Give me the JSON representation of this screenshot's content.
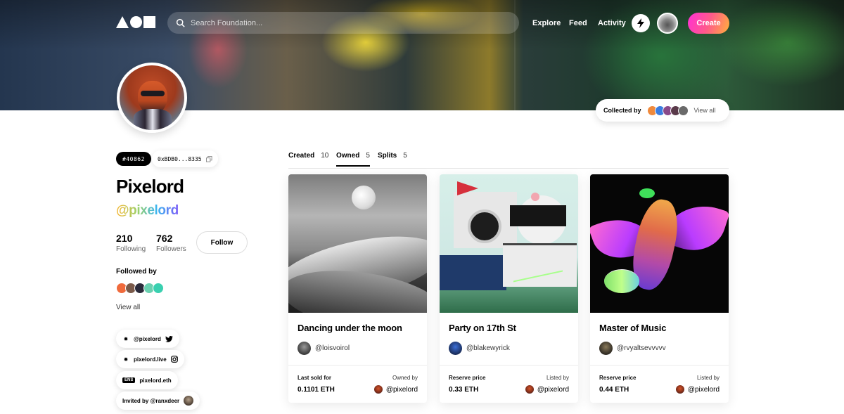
{
  "nav": {
    "search_placeholder": "Search Foundation...",
    "links": [
      "Explore",
      "Feed",
      "Activity"
    ],
    "create_label": "Create"
  },
  "collected": {
    "label": "Collected by",
    "view_all": "View all",
    "avatar_colors": [
      "#f08a3c",
      "#3b7de0",
      "#8a4a8a",
      "#5a3a4a",
      "#6a6a6a"
    ]
  },
  "profile": {
    "token_id": "#40862",
    "address": "0xBDB0...8335",
    "name": "Pixelord",
    "handle": "@pixelord",
    "following_count": "210",
    "following_label": "Following",
    "followers_count": "762",
    "followers_label": "Followers",
    "follow_label": "Follow",
    "followed_by_label": "Followed by",
    "followed_by_colors": [
      "#f06a3c",
      "#7a5a4a",
      "#2a2a3a",
      "#6ad0b0",
      "#3ad0b0"
    ],
    "view_all": "View all",
    "links": [
      {
        "icon": "gear-icon",
        "text": "@pixelord",
        "trail_icon": "twitter-icon"
      },
      {
        "icon": "gear-icon",
        "text": "pixelord.live",
        "trail_icon": "instagram-icon"
      },
      {
        "icon": "ens-icon",
        "badge": "ENS",
        "text": "pixelord.eth"
      },
      {
        "icon": "",
        "text": "Invited by @ranxdeer"
      }
    ]
  },
  "tabs": [
    {
      "label": "Created",
      "count": "10"
    },
    {
      "label": "Owned",
      "count": "5",
      "active": true
    },
    {
      "label": "Splits",
      "count": "5"
    }
  ],
  "cards": [
    {
      "title": "Dancing under the moon",
      "creator": "@loisvoirol",
      "left_label": "Last sold for",
      "left_value": "0.1101 ETH",
      "right_label": "Owned by",
      "right_value": "@pixelord"
    },
    {
      "title": "Party on 17th St",
      "creator": "@blakewyrick",
      "left_label": "Reserve price",
      "left_value": "0.33 ETH",
      "right_label": "Listed by",
      "right_value": "@pixelord"
    },
    {
      "title": "Master of Music",
      "creator": "@rvyaltsevvvvv",
      "left_label": "Reserve price",
      "left_value": "0.44 ETH",
      "right_label": "Listed by",
      "right_value": "@pixelord"
    }
  ]
}
